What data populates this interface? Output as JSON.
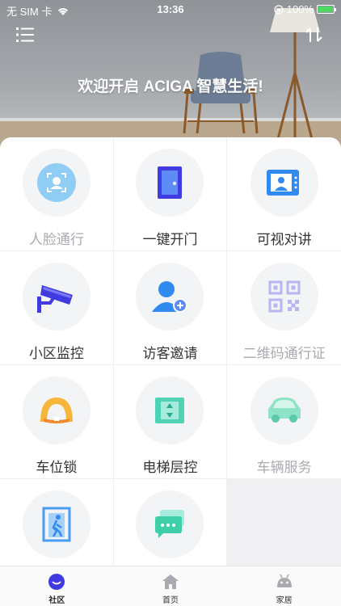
{
  "status_bar": {
    "carrier": "无 SIM 卡",
    "time": "13:36",
    "battery_percent": "100%"
  },
  "hero": {
    "welcome_text": "欢迎开启 ACIGA 智慧生活!"
  },
  "features": [
    {
      "label": "人脸通行",
      "icon": "face-recognition-icon",
      "enabled": false
    },
    {
      "label": "一键开门",
      "icon": "door-icon",
      "enabled": true
    },
    {
      "label": "可视对讲",
      "icon": "video-intercom-icon",
      "enabled": true
    },
    {
      "label": "小区监控",
      "icon": "surveillance-camera-icon",
      "enabled": true
    },
    {
      "label": "访客邀请",
      "icon": "add-visitor-icon",
      "enabled": true
    },
    {
      "label": "二维码通行证",
      "icon": "qr-code-icon",
      "enabled": false
    },
    {
      "label": "车位锁",
      "icon": "parking-lock-icon",
      "enabled": true
    },
    {
      "label": "电梯层控",
      "icon": "elevator-icon",
      "enabled": true
    },
    {
      "label": "车辆服务",
      "icon": "car-icon",
      "enabled": false
    },
    {
      "label": "",
      "icon": "emergency-exit-icon",
      "enabled": true
    },
    {
      "label": "",
      "icon": "message-icon",
      "enabled": true
    }
  ],
  "tabs": [
    {
      "label": "社区",
      "icon": "community-smile-icon",
      "active": true
    },
    {
      "label": "首页",
      "icon": "home-icon",
      "active": false
    },
    {
      "label": "家居",
      "icon": "robot-icon",
      "active": false
    }
  ],
  "colors": {
    "accent": "#3f3be0",
    "disabled_text": "#a9abb0"
  }
}
